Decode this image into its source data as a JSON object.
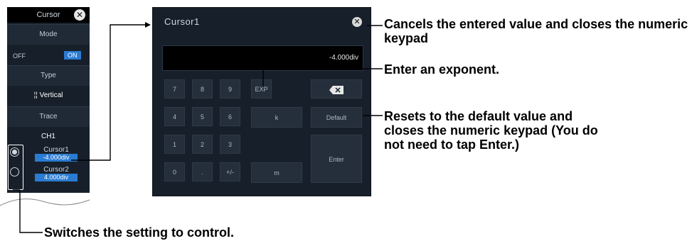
{
  "menu": {
    "title": "Cursor",
    "mode_label": "Mode",
    "mode_off": "OFF",
    "mode_on": "ON",
    "type_label": "Type",
    "type_icon": "vertical-cursor-icon",
    "type_value": "¦¦ Vertical",
    "trace_label": "Trace",
    "trace_value": "CH1",
    "cursors": [
      {
        "name": "Cursor1",
        "value": "-4.000div",
        "selected": true
      },
      {
        "name": "Cursor2",
        "value": "4.000div",
        "selected": false
      }
    ]
  },
  "keypad": {
    "title": "Cursor1",
    "display_value": "-4.000div",
    "keys": {
      "k7": "7",
      "k8": "8",
      "k9": "9",
      "exp": "EXP",
      "k4": "4",
      "k5": "5",
      "k6": "6",
      "kilo": "k",
      "default": "Default",
      "k1": "1",
      "k2": "2",
      "k3": "3",
      "enter": "Enter",
      "k0": "0",
      "dot": ".",
      "sign": "+/-",
      "milli": "m"
    },
    "backspace_icon": "backspace-icon",
    "close_icon": "close-icon"
  },
  "annotations": {
    "close": "Cancels the entered value and closes the numeric keypad",
    "exp": "Enter an exponent.",
    "default": "Resets to the default value and closes the numeric keypad (You do not need to tap Enter.)",
    "switch": "Switches the setting to control."
  }
}
